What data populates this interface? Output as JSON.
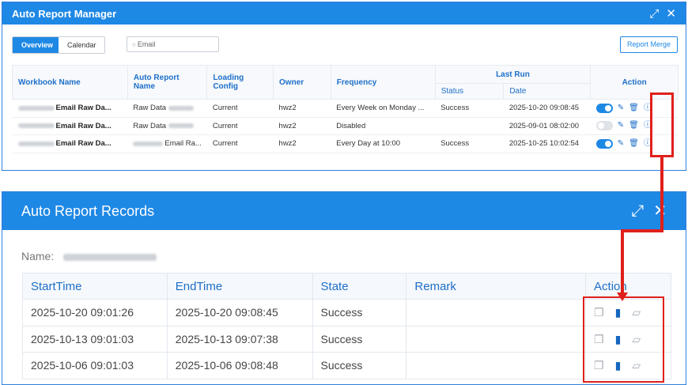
{
  "window1": {
    "title": "Auto Report Manager",
    "tabs": [
      "Overview",
      "Calendar"
    ],
    "search_value": "Email",
    "report_merge_label": "Report Merge",
    "columns": {
      "workbook": "Workbook Name",
      "auto_report": "Auto Report Name",
      "loading": "Loading Config",
      "owner": "Owner",
      "frequency": "Frequency",
      "last_run": "Last Run",
      "status": "Status",
      "date": "Date",
      "action": "Action"
    },
    "rows": [
      {
        "workbook": "Email Raw Da...",
        "auto_report": "Raw Data ",
        "loading": "Current",
        "owner": "hwz2",
        "frequency": "Every Week on Monday ...",
        "status": "Success",
        "date": "2025-10-20 09:08:45",
        "enabled": true
      },
      {
        "workbook": "Email Raw Da...",
        "auto_report": "Raw Data ",
        "loading": "Current",
        "owner": "hwz2",
        "frequency": "Disabled",
        "status": "",
        "date": "2025-09-01 08:02:00",
        "enabled": false
      },
      {
        "workbook": "Email Raw Da...",
        "auto_report": "Email Ra...",
        "loading": "Current",
        "owner": "hwz2",
        "frequency": "Every Day at 10:00",
        "status": "Success",
        "date": "2025-10-25 10:02:54",
        "enabled": true
      }
    ]
  },
  "window2": {
    "title": "Auto Report Records",
    "name_label": "Name:",
    "columns": {
      "start": "StartTime",
      "end": "EndTime",
      "state": "State",
      "remark": "Remark",
      "action": "Action"
    },
    "rows": [
      {
        "start": "2025-10-20 09:01:26",
        "end": "2025-10-20 09:08:45",
        "state": "Success",
        "remark": ""
      },
      {
        "start": "2025-10-13 09:01:03",
        "end": "2025-10-13 09:07:38",
        "state": "Success",
        "remark": ""
      },
      {
        "start": "2025-10-06 09:01:03",
        "end": "2025-10-06 09:08:48",
        "state": "Success",
        "remark": ""
      }
    ]
  },
  "colors": {
    "accent": "#1e88e5",
    "success": "#52c41a",
    "annotation": "#e0201b"
  },
  "icons": [
    "expand-icon",
    "close-icon",
    "search-icon",
    "edit-icon",
    "delete-icon",
    "info-icon",
    "copy-icon",
    "file-icon",
    "image-icon"
  ]
}
